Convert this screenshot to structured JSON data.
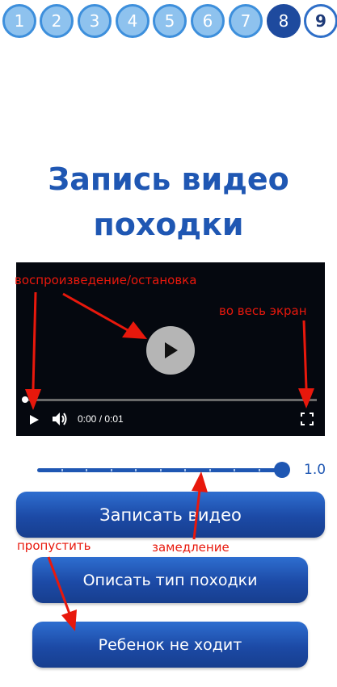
{
  "steps": [
    {
      "label": "1",
      "state": "done"
    },
    {
      "label": "2",
      "state": "done"
    },
    {
      "label": "3",
      "state": "done"
    },
    {
      "label": "4",
      "state": "done"
    },
    {
      "label": "5",
      "state": "done"
    },
    {
      "label": "6",
      "state": "done"
    },
    {
      "label": "7",
      "state": "done"
    },
    {
      "label": "8",
      "state": "current"
    },
    {
      "label": "9",
      "state": "next"
    }
  ],
  "page": {
    "title_line1": "Запись видео",
    "title_line2": "походки"
  },
  "video": {
    "time_display": "0:00 / 0:01",
    "progress": 0,
    "icons": {
      "center": "play-icon",
      "play": "play-icon",
      "volume": "volume-icon",
      "fullscreen": "fullscreen-icon"
    }
  },
  "speed_slider": {
    "value": "1.0",
    "level": 1.0
  },
  "buttons": {
    "record": "Записать видео",
    "describe_gait": "Описать тип походки",
    "child_not_walking": "Ребенок не ходит"
  },
  "annotations": {
    "play_pause": "воспроизведение/остановка",
    "fullscreen": "во весь экран",
    "slow_down": "замедление",
    "skip": "пропустить"
  },
  "colors": {
    "primary": "#1f57b3",
    "step_done": "#8ec2ee",
    "step_current": "#1e4a9e",
    "annotation": "#e8180c",
    "video_bg": "#05080f"
  }
}
